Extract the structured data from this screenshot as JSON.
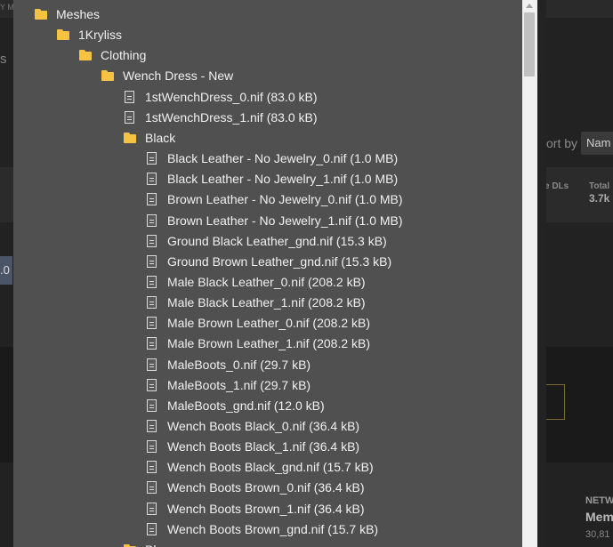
{
  "background": {
    "sort_label": "ort by",
    "sort_value": "Nam",
    "dls_label": "e DLs",
    "total_label": "Total",
    "total_value": "3.7k",
    "netw_label": "NETW",
    "mem_label": "Mem",
    "count_value": "30,81",
    "left_s": "s",
    "left_0": ".0",
    "top_label": "Y M"
  },
  "tree": [
    {
      "label": "Meshes",
      "type": "folder",
      "level": 0
    },
    {
      "label": "1Kryliss",
      "type": "folder",
      "level": 1
    },
    {
      "label": "Clothing",
      "type": "folder",
      "level": 2
    },
    {
      "label": "Wench Dress - New",
      "type": "folder",
      "level": 3
    },
    {
      "label": "1stWenchDress_0.nif (83.0 kB)",
      "type": "file",
      "level": 4
    },
    {
      "label": "1stWenchDress_1.nif (83.0 kB)",
      "type": "file",
      "level": 4
    },
    {
      "label": "Black",
      "type": "folder",
      "level": 4
    },
    {
      "label": "Black Leather - No Jewelry_0.nif (1.0 MB)",
      "type": "file",
      "level": 5
    },
    {
      "label": "Black Leather - No Jewelry_1.nif (1.0 MB)",
      "type": "file",
      "level": 5
    },
    {
      "label": "Brown Leather - No Jewelry_0.nif (1.0 MB)",
      "type": "file",
      "level": 5
    },
    {
      "label": "Brown Leather - No Jewelry_1.nif (1.0 MB)",
      "type": "file",
      "level": 5
    },
    {
      "label": "Ground Black Leather_gnd.nif (15.3 kB)",
      "type": "file",
      "level": 5
    },
    {
      "label": "Ground Brown Leather_gnd.nif (15.3 kB)",
      "type": "file",
      "level": 5
    },
    {
      "label": "Male Black Leather_0.nif (208.2 kB)",
      "type": "file",
      "level": 5
    },
    {
      "label": "Male Black Leather_1.nif (208.2 kB)",
      "type": "file",
      "level": 5
    },
    {
      "label": "Male Brown Leather_0.nif (208.2 kB)",
      "type": "file",
      "level": 5
    },
    {
      "label": "Male Brown Leather_1.nif (208.2 kB)",
      "type": "file",
      "level": 5
    },
    {
      "label": "MaleBoots_0.nif (29.7 kB)",
      "type": "file",
      "level": 5
    },
    {
      "label": "MaleBoots_1.nif (29.7 kB)",
      "type": "file",
      "level": 5
    },
    {
      "label": "MaleBoots_gnd.nif (12.0 kB)",
      "type": "file",
      "level": 5
    },
    {
      "label": "Wench Boots Black_0.nif (36.4 kB)",
      "type": "file",
      "level": 5
    },
    {
      "label": "Wench Boots Black_1.nif (36.4 kB)",
      "type": "file",
      "level": 5
    },
    {
      "label": "Wench Boots Black_gnd.nif (15.7 kB)",
      "type": "file",
      "level": 5
    },
    {
      "label": "Wench Boots Brown_0.nif (36.4 kB)",
      "type": "file",
      "level": 5
    },
    {
      "label": "Wench Boots Brown_1.nif (36.4 kB)",
      "type": "file",
      "level": 5
    },
    {
      "label": "Wench Boots Brown_gnd.nif (15.7 kB)",
      "type": "file",
      "level": 5
    },
    {
      "label": "Blu",
      "type": "folder",
      "level": 4
    }
  ]
}
